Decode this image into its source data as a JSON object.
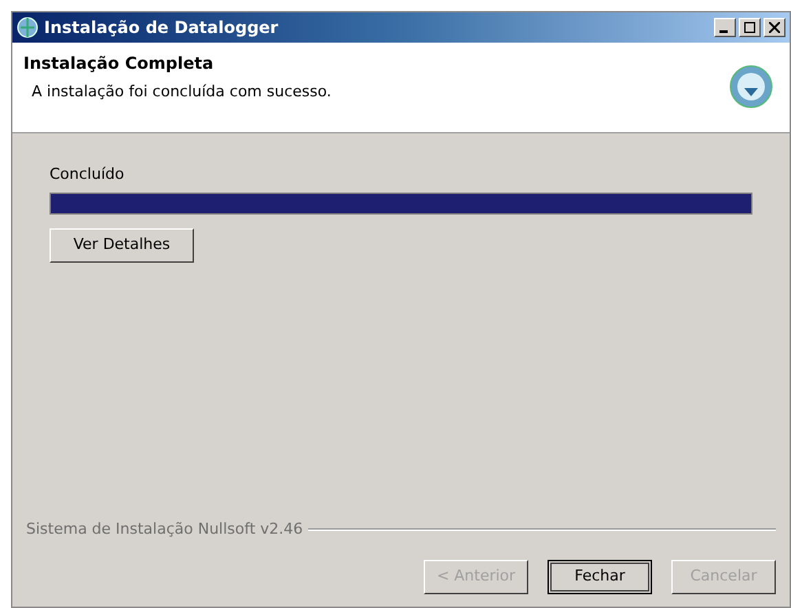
{
  "window": {
    "title": "Instalação de Datalogger"
  },
  "header": {
    "title": "Instalação Completa",
    "subtitle": "A instalação foi concluída com sucesso."
  },
  "progress": {
    "label": "Concluído",
    "level": 1
  },
  "details_button": {
    "label": "Ver Detalhes"
  },
  "footer": {
    "branding": "Sistema de Instalação Nullsoft v2.46"
  },
  "buttons": [
    {
      "label": "< Anterior",
      "disabled": true,
      "default": false
    },
    {
      "label": "Fechar",
      "disabled": false,
      "default": true
    },
    {
      "label": "Cancelar",
      "disabled": true,
      "default": false
    }
  ]
}
